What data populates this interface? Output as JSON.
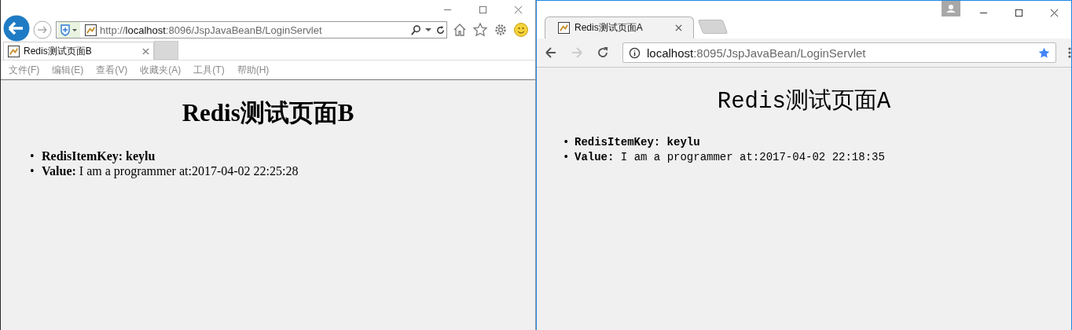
{
  "left_window": {
    "address_bar": {
      "scheme": "http://",
      "host": "localhost",
      "path": ":8096/JspJavaBeanB/LoginServlet"
    },
    "forward_button": {
      "disabled": true
    },
    "tabs": [
      {
        "label": "Redis测试页面B",
        "selected": true,
        "kind": "page"
      },
      {
        "selected": false,
        "kind": "new"
      }
    ],
    "menu": [
      "文件(F)",
      "编辑(E)",
      "查看(V)",
      "收藏夹(A)",
      "工具(T)",
      "帮助(H)"
    ],
    "page": {
      "heading": "Redis测试页面B",
      "items": [
        {
          "bullet": "•",
          "text": "**RedisItemKey: keylu**"
        },
        {
          "bullet": "•",
          "text": "**Value:** I am a programmer at:2017-04-02 22:25:28"
        }
      ]
    }
  },
  "right_window": {
    "tabs": [
      {
        "label": "Redis测试页面A",
        "selected": true,
        "kind": "page"
      },
      {
        "selected": false,
        "kind": "new"
      }
    ],
    "forward_button": {
      "disabled": true
    },
    "address_bar": {
      "host": "localhost",
      "path": ":8095/JspJavaBean/LoginServlet"
    },
    "page": {
      "heading": "Redis测试页面A",
      "items": [
        {
          "bullet": "•",
          "text": "**RedisItemKey: keylu**"
        },
        {
          "bullet": "•",
          "text": "**Value:** I am a programmer at:2017-04-02 22:18:35"
        }
      ]
    }
  }
}
